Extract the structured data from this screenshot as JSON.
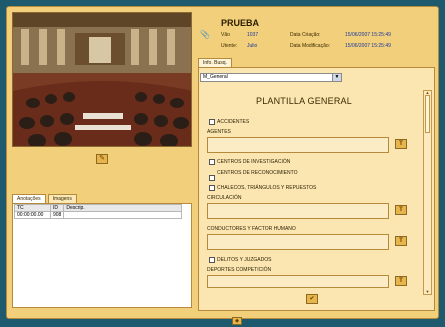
{
  "header": {
    "title": "PRUEBA",
    "info": [
      {
        "label": "Vão",
        "value": "1037"
      },
      {
        "label": "Data Criação:",
        "value": "15/06/2007 15:25:49"
      },
      {
        "label": "Utente:",
        "value": "Julio"
      },
      {
        "label": "Data Modificação:",
        "value": "15/06/2007 15:25:49"
      }
    ]
  },
  "left": {
    "photo_button_icon": "edit-icon",
    "tabs": [
      "Anotações",
      "Imagens"
    ],
    "table": {
      "headers": [
        "TC",
        "ID",
        "Descrip."
      ],
      "rows": [
        [
          "00:00:00.00",
          "908",
          ""
        ]
      ]
    }
  },
  "right": {
    "tab_label": "Info. Busq.",
    "select_value": "M_General",
    "template_title": "PLANTILLA GENERAL",
    "items": {
      "accidentes_check": "ACCIDENTES",
      "agentes_label": "AGENTES",
      "centros_inv_check": "CENTROS DE INVESTIGACIÓN",
      "centros_rec_check": "CENTROS DE RECONOCIMIENTO",
      "chalecos_check": "CHALECOS, TRIÁNGULOS Y REPUESTOS",
      "circulacion_label": "CIRCULACIÓN",
      "conductores_label": "CONDUCTORES Y FACTOR HUMANO",
      "delitos_check": "DELITOS Y JUZGADOS",
      "deportes_label": "DEPORTES COMPETICIÓN"
    },
    "t_button": "T"
  },
  "colors": {
    "background": "#1d5a6e",
    "panel": "#f2cf7a",
    "accent_button": "#e6b64c",
    "value_text": "#1a36a0"
  }
}
